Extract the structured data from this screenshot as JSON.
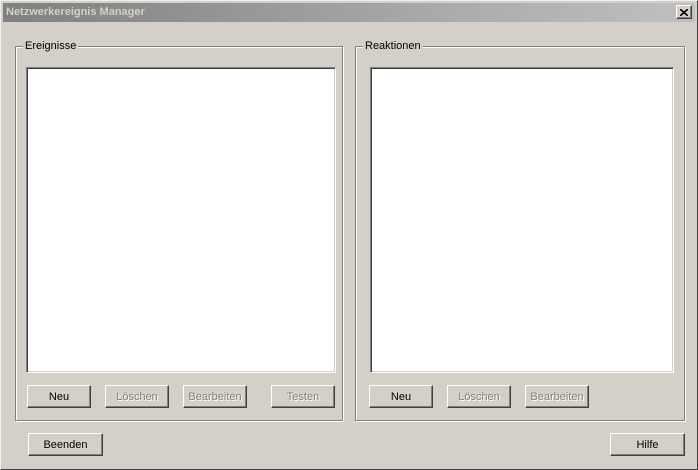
{
  "window": {
    "title": "Netzwerkereignis Manager"
  },
  "events_group": {
    "label": "Ereignisse",
    "buttons": {
      "new": "Neu",
      "delete": "Löschen",
      "edit": "Bearbeiten",
      "test": "Testen"
    }
  },
  "reactions_group": {
    "label": "Reaktionen",
    "buttons": {
      "new": "Neu",
      "delete": "Löschen",
      "edit": "Bearbeiten"
    }
  },
  "footer": {
    "quit": "Beenden",
    "help": "Hilfe"
  },
  "icons": {
    "close": "close-icon"
  }
}
